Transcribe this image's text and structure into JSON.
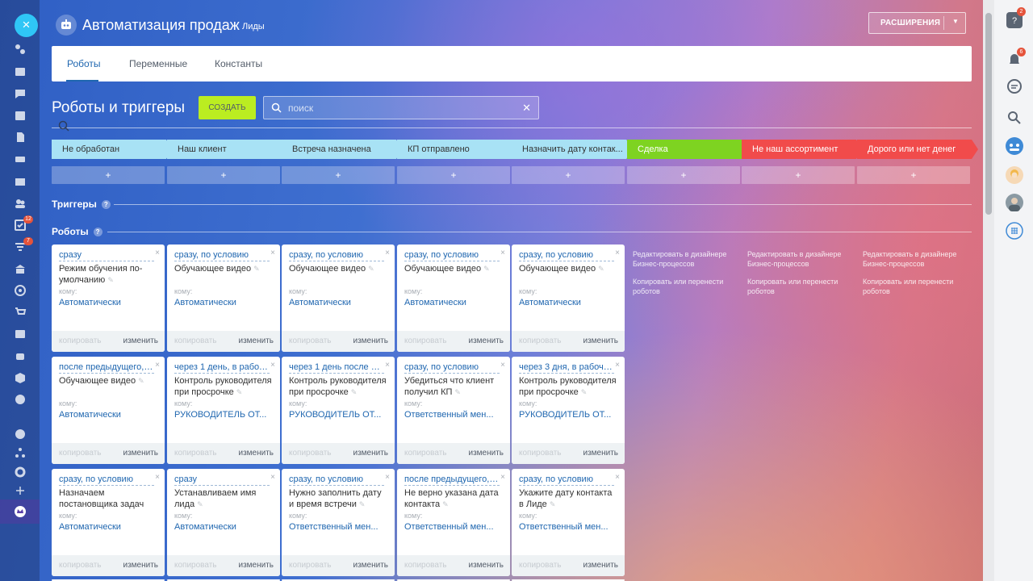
{
  "header": {
    "title": "Автоматизация продаж",
    "subtitle": "Лиды",
    "extensions_label": "РАСШИРЕНИЯ"
  },
  "tabs": [
    {
      "label": "Роботы",
      "active": true
    },
    {
      "label": "Переменные",
      "active": false
    },
    {
      "label": "Константы",
      "active": false
    }
  ],
  "toolbar": {
    "heading": "Роботы и триггеры",
    "create_label": "СОЗДАТЬ",
    "search_placeholder": "поиск"
  },
  "stages": [
    {
      "label": "Не обработан",
      "color": "#a8e2f5"
    },
    {
      "label": "Наш клиент",
      "color": "#a8e2f5"
    },
    {
      "label": "Встреча назначена",
      "color": "#a8e2f5"
    },
    {
      "label": "КП отправлено",
      "color": "#a8e2f5"
    },
    {
      "label": "Назначить дату контак...",
      "color": "#a8e2f5"
    },
    {
      "label": "Сделка",
      "color": "#7ed321"
    },
    {
      "label": "Не наш ассортимент",
      "color": "#f14b4b"
    },
    {
      "label": "Дорого или нет денег",
      "color": "#f14b4b"
    }
  ],
  "stage_add_label": "+",
  "sections": {
    "triggers": "Триггеры",
    "robots": "Роботы",
    "help_glyph": "?"
  },
  "card_labels": {
    "to": "кому:",
    "copy": "копировать",
    "edit": "изменить",
    "close": "×",
    "pencil": "✎"
  },
  "cards": [
    [
      {
        "cond": "сразу",
        "title": "Режим обучения по-умолчанию",
        "to": "Автоматически"
      },
      {
        "cond": "сразу, по условию",
        "title": "Обучающее видео",
        "to": "Автоматически"
      },
      {
        "cond": "сразу, по условию",
        "title": "Обучающее видео",
        "to": "Автоматически"
      },
      {
        "cond": "сразу, по условию",
        "title": "Обучающее видео",
        "to": "Автоматически"
      },
      {
        "cond": "сразу, по условию",
        "title": "Обучающее видео",
        "to": "Автоматически"
      }
    ],
    [
      {
        "cond": "после предыдущего, п...",
        "title": "Обучающее видео",
        "to": "Автоматически"
      },
      {
        "cond": "через 1 день, в рабоч...",
        "title": "Контроль руководителя при просрочке",
        "to": "РУКОВОДИТЕЛЬ ОТ..."
      },
      {
        "cond": "через 1 день после Да...",
        "title": "Контроль руководителя при просрочке",
        "to": "РУКОВОДИТЕЛЬ ОТ..."
      },
      {
        "cond": "сразу, по условию",
        "title": "Убедиться что клиент получил КП",
        "to": "Ответственный мен..."
      },
      {
        "cond": "через 3 дня, в рабоче...",
        "title": "Контроль руководителя при просрочке",
        "to": "РУКОВОДИТЕЛЬ ОТ..."
      }
    ],
    [
      {
        "cond": "сразу, по условию",
        "title": "Назначаем постановщика задач по",
        "to": "Автоматически"
      },
      {
        "cond": "сразу",
        "title": "Устанавливаем имя лида",
        "to": "Автоматически"
      },
      {
        "cond": "сразу, по условию",
        "title": "Нужно заполнить дату и время встречи",
        "to": "Ответственный мен..."
      },
      {
        "cond": "после предыдущего, п...",
        "title": "Не верно указана дата контакта",
        "to": "Ответственный мен..."
      },
      {
        "cond": "сразу, по условию",
        "title": "Укажите дату контакта в Лиде",
        "to": "Ответственный мен..."
      }
    ]
  ],
  "bp_links": {
    "edit": "Редактировать в дизайнере Бизнес-процессов",
    "copy": "Копировать или перенести роботов"
  },
  "rail_badges": {
    "tasks": "12",
    "feed": "7",
    "help": "2",
    "notifications": "6"
  }
}
